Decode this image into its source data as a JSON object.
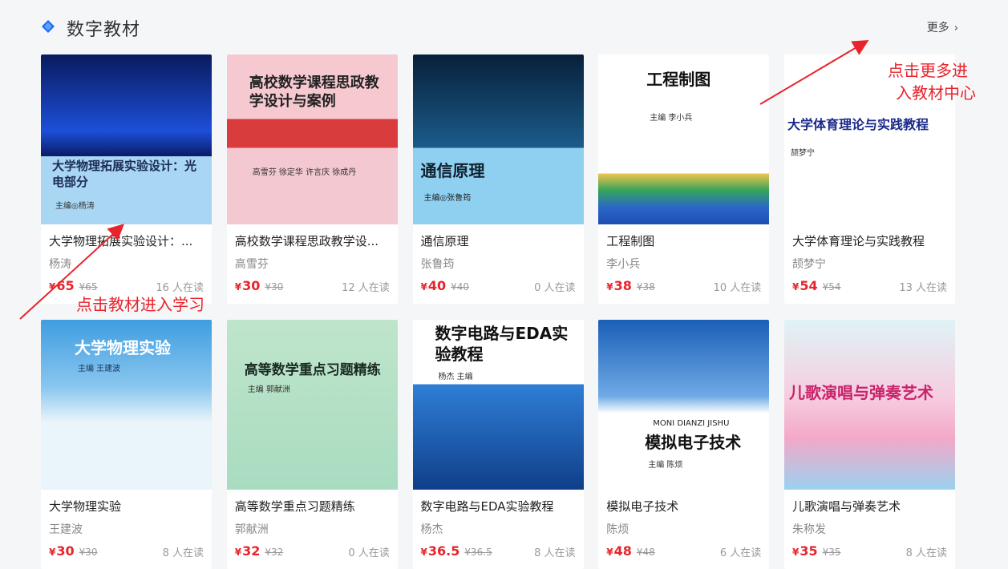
{
  "header": {
    "title": "数字教材",
    "more_label": "更多"
  },
  "colors": {
    "brand": "#1a6cf0",
    "price": "#e8232b",
    "annotation": "#e8232b"
  },
  "annotations": {
    "more_tip_line1": "点击更多进",
    "more_tip_line2": "入教材中心",
    "book_tip": "点击教材进入学习"
  },
  "books": [
    {
      "title": "大学物理拓展实验设计：...",
      "author": "杨涛",
      "price": "65",
      "original": "¥65",
      "readers": "16 人在读",
      "cover": {
        "title": "大学物理拓展实验设计：光电部分",
        "author": "主编◎杨涛"
      }
    },
    {
      "title": "高校数学课程思政教学设...",
      "author": "高雪芬",
      "price": "30",
      "original": "¥30",
      "readers": "12 人在读",
      "cover": {
        "title": "高校数学课程思政教学设计与案例",
        "author": "高雪芬 徐定华 许言庆 徐成丹"
      }
    },
    {
      "title": "通信原理",
      "author": "张鲁筠",
      "price": "40",
      "original": "¥40",
      "readers": "0 人在读",
      "cover": {
        "title": "通信原理",
        "author": "主编◎张鲁筠"
      }
    },
    {
      "title": "工程制图",
      "author": "李小兵",
      "price": "38",
      "original": "¥38",
      "readers": "10 人在读",
      "cover": {
        "title": "工程制图",
        "author": "主编 李小兵"
      }
    },
    {
      "title": "大学体育理论与实践教程",
      "author": "颉梦宁",
      "price": "54",
      "original": "¥54",
      "readers": "13 人在读",
      "cover": {
        "title": "大学体育理论与实践教程",
        "author": "颉梦宁"
      }
    },
    {
      "title": "大学物理实验",
      "author": "王建波",
      "price": "30",
      "original": "¥30",
      "readers": "8 人在读",
      "cover": {
        "title": "大学物理实验",
        "author": "主编 王建波"
      }
    },
    {
      "title": "高等数学重点习题精练",
      "author": "郭献洲",
      "price": "32",
      "original": "¥32",
      "readers": "0 人在读",
      "cover": {
        "title": "高等数学重点习题精练",
        "author": "主编 郭献洲"
      }
    },
    {
      "title": "数字电路与EDA实验教程",
      "author": "杨杰",
      "price": "36.5",
      "original": "¥36.5",
      "readers": "8 人在读",
      "cover": {
        "title": "数字电路与EDA实验教程",
        "author": "杨杰 主编"
      }
    },
    {
      "title": "模拟电子技术",
      "author": "陈烦",
      "price": "48",
      "original": "¥48",
      "readers": "6 人在读",
      "cover": {
        "title": "模拟电子技术",
        "subtitle": "MONI DIANZI JISHU",
        "author": "主编 陈烦"
      }
    },
    {
      "title": "儿歌演唱与弹奏艺术",
      "author": "朱称发",
      "price": "35",
      "original": "¥35",
      "readers": "8 人在读",
      "cover": {
        "title": "儿歌演唱与弹奏艺术"
      }
    }
  ]
}
